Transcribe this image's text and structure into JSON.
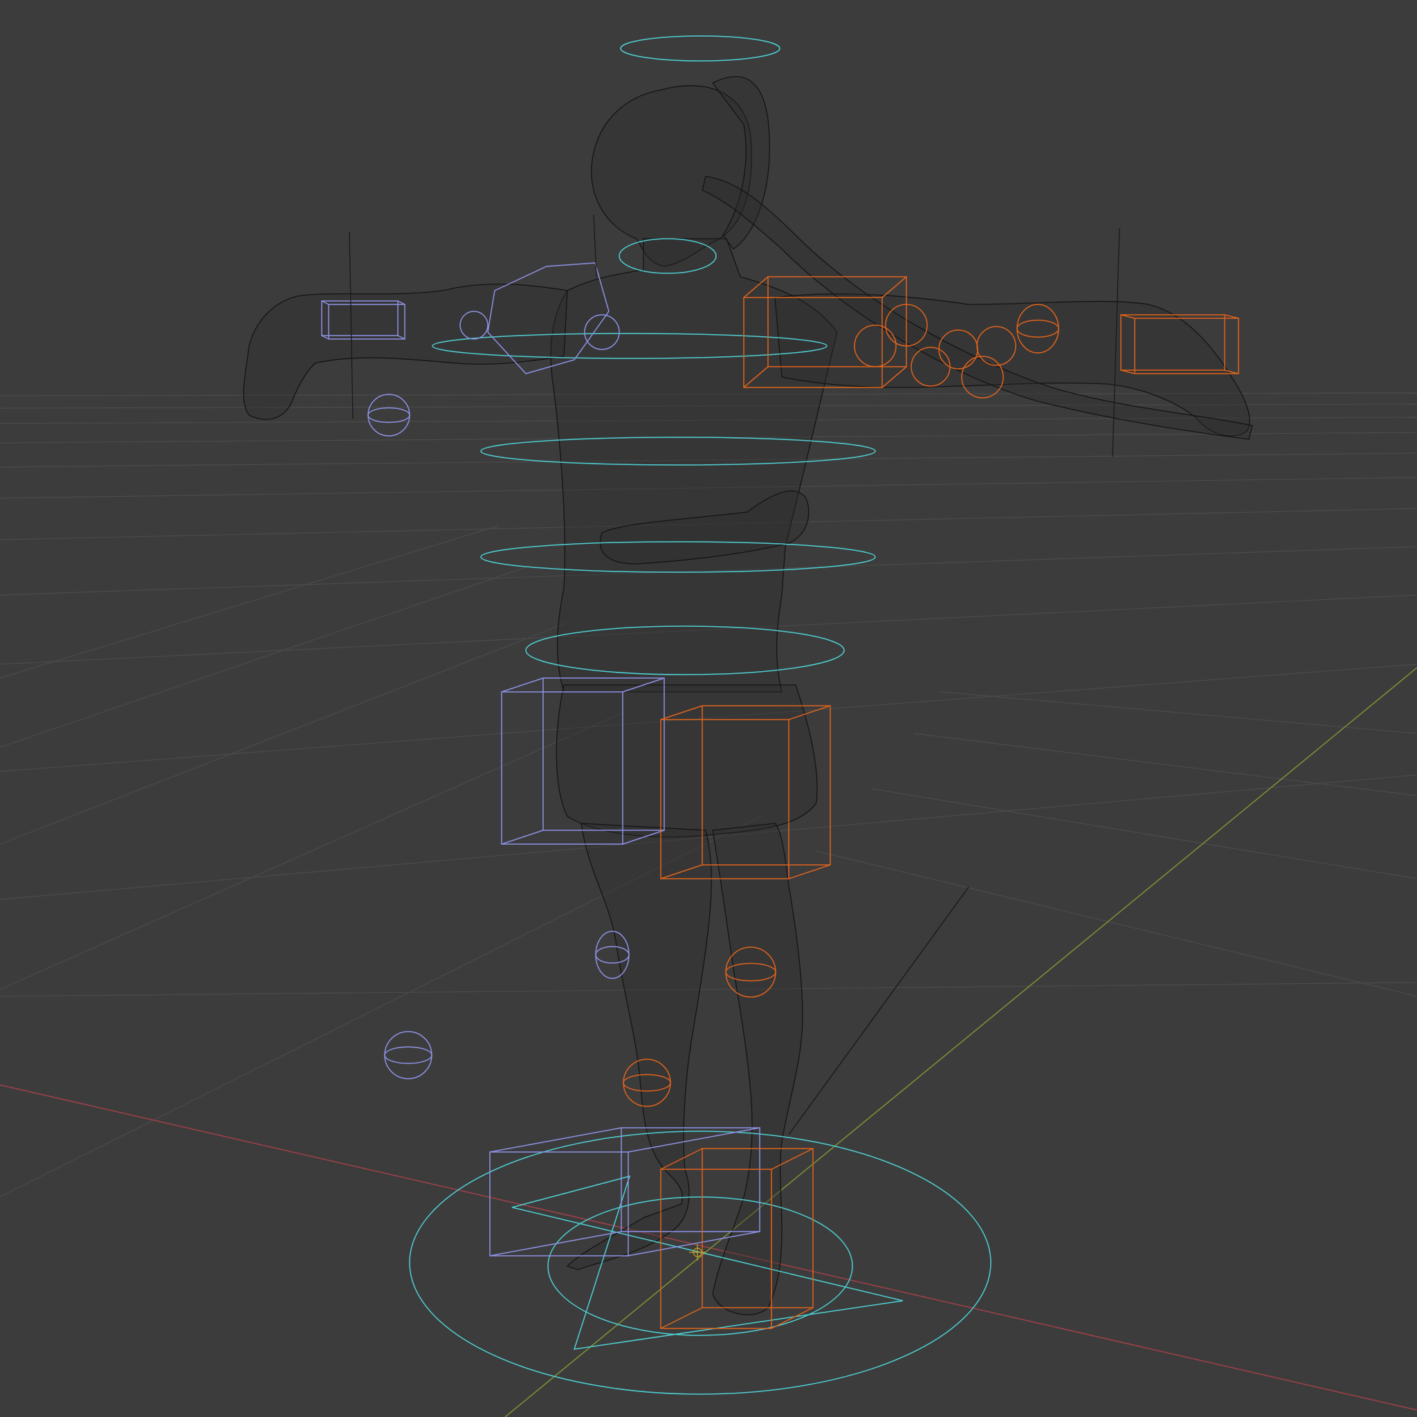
{
  "viewport": {
    "shading_mode": "wireframe",
    "view": "perspective",
    "background_color": "#3c3c3c"
  },
  "colors": {
    "grid": "#4b4b4b",
    "axis_x": "#9b4048",
    "axis_y": "#7a8f36",
    "mesh": "#141414",
    "widget_ik_left": "#8e92e6",
    "widget_ik_right": "#e0631c",
    "widget_fk": "#4fd0d4"
  },
  "scene": {
    "object": "character-mesh",
    "rig_controls": [
      "root-circle-control",
      "hip-circle-control",
      "spine-circle-control",
      "chest-circle-control",
      "neck-circle-control",
      "head-circle-control",
      "left-arm-ik-box",
      "right-arm-ik-box",
      "left-leg-ik-box",
      "right-leg-ik-box",
      "left-foot-ik-box",
      "right-foot-ik-box",
      "left-knee-pole-target",
      "right-knee-pole-target",
      "left-elbow-pole-target"
    ]
  }
}
